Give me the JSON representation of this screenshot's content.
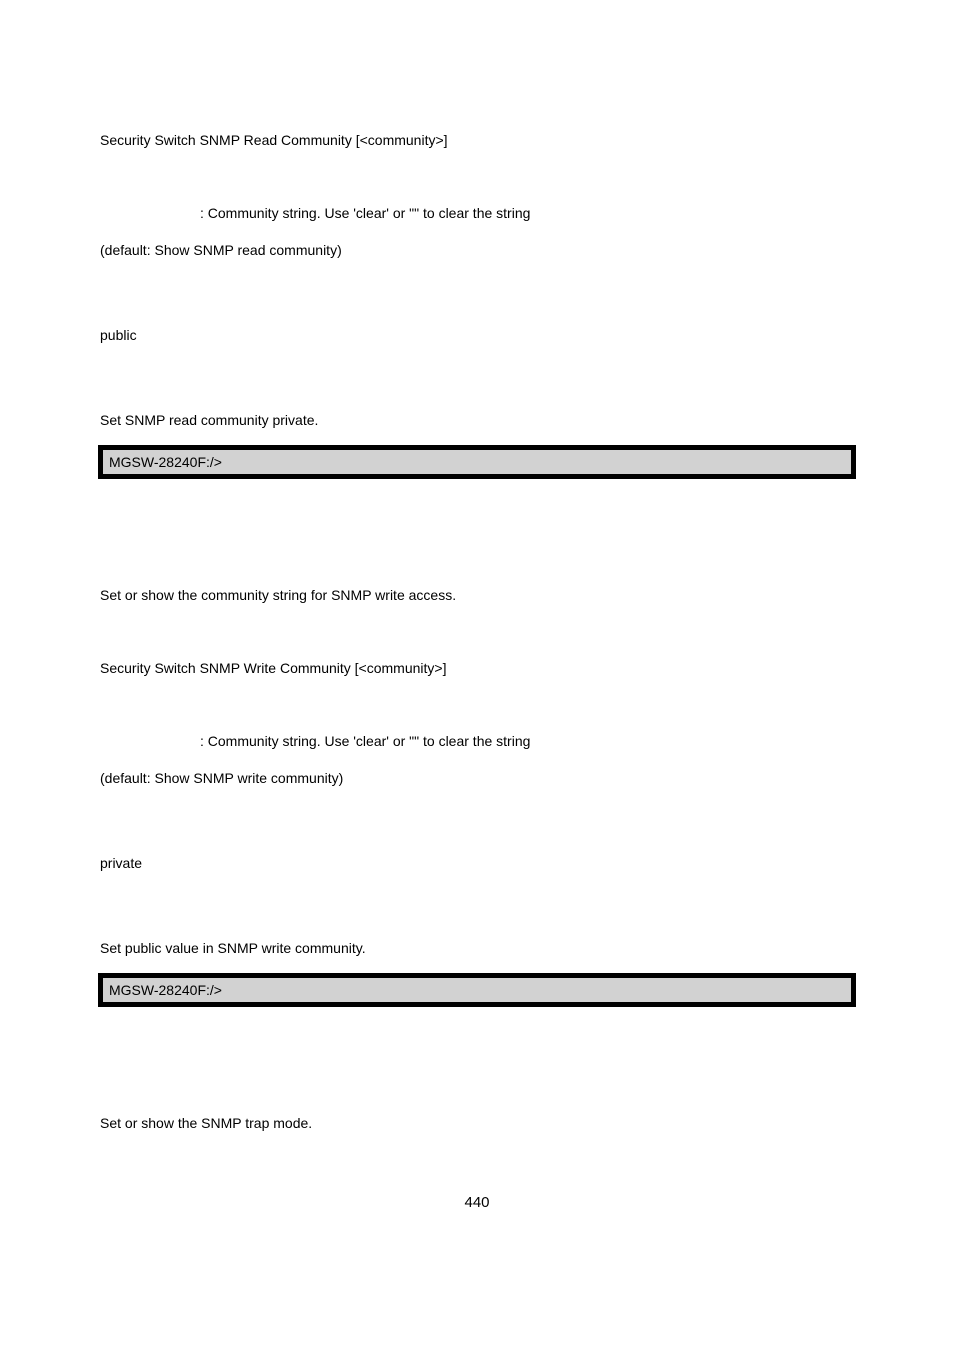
{
  "section1": {
    "syntax": "Security Switch SNMP Read Community [<community>]",
    "param_desc": ": Community string. Use 'clear' or \"\" to clear the string",
    "default_note": "(default: Show SNMP read community)",
    "value": "public",
    "example_intro": "Set SNMP read community private.",
    "terminal": "MGSW-28240F:/>"
  },
  "section2": {
    "description": "Set or show the community string for SNMP write access.",
    "syntax": "Security Switch SNMP Write Community [<community>]",
    "param_desc": ": Community string. Use 'clear' or \"\" to clear the string",
    "default_note": "(default: Show SNMP write community)",
    "value": "private",
    "example_intro": "Set public value in SNMP write community.",
    "terminal": "MGSW-28240F:/>"
  },
  "section3": {
    "description": "Set or show the SNMP trap mode."
  },
  "page_number": "440"
}
